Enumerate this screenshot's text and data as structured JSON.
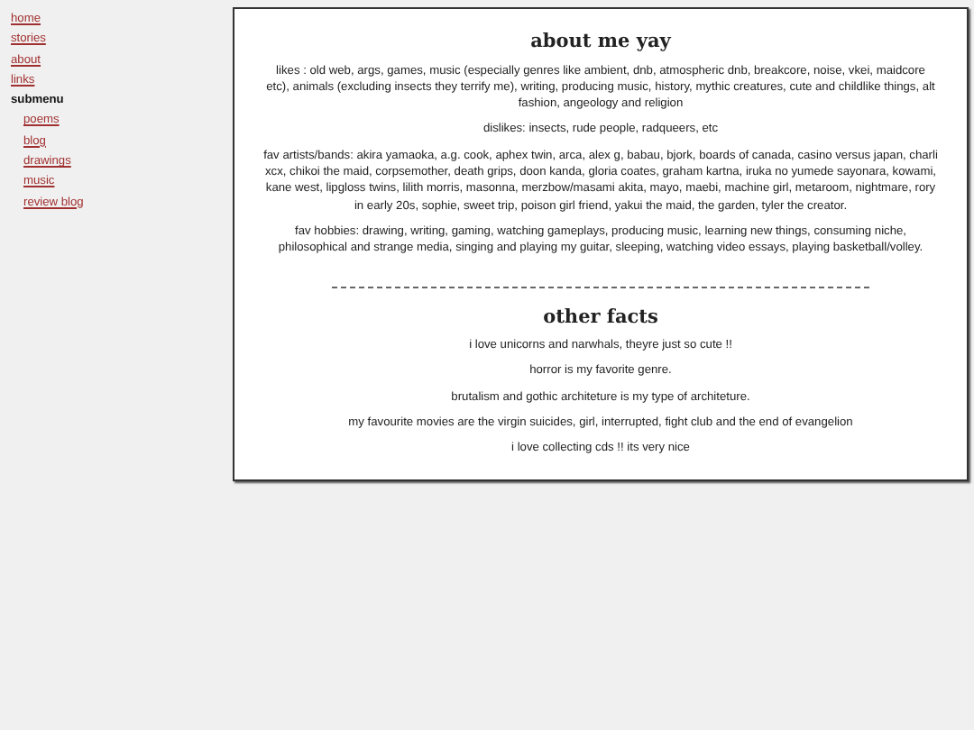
{
  "sidebar": {
    "items": [
      {
        "label": "home",
        "kind": "link"
      },
      {
        "label": "stories",
        "kind": "link"
      },
      {
        "label": "about",
        "kind": "link"
      },
      {
        "label": "links",
        "kind": "link"
      },
      {
        "label": "submenu",
        "kind": "heading",
        "children": [
          {
            "label": "poems"
          },
          {
            "label": "blog"
          },
          {
            "label": "drawings"
          },
          {
            "label": "music"
          },
          {
            "label": "review blog"
          }
        ]
      }
    ]
  },
  "main": {
    "sections": [
      {
        "title": "about me yay",
        "paragraphs": [
          "likes : old web, args, games, music (especially genres like ambient, dnb, atmospheric dnb, breakcore, noise, vkei, maidcore etc), animals (excluding insects they terrify me), writing, producing music, history, mythic creatures, cute and childlike things, alt fashion, angeology and religion",
          "dislikes: insects, rude people, radqueers, etc",
          "fav artists/bands: akira yamaoka, a.g. cook, aphex twin, arca, alex g, babau, bjork, boards of canada, casino versus japan, charli xcx, chikoi the maid, corpsemother, death grips, doon kanda, gloria coates, graham kartna, iruka no yumede sayonara, kowami, kane west, lipgloss twins, lilith morris, masonna, merzbow/masami akita, mayo, maebi, machine girl, metaroom, nightmare, rory in early 20s, sophie, sweet trip, poison girl friend, yakui the maid, the garden, tyler the creator.",
          "fav hobbies: drawing, writing, gaming, watching gameplays, producing music, learning new things, consuming niche, philosophical and strange media, singing and playing my guitar, sleeping, watching video essays, playing basketball/volley."
        ]
      },
      {
        "title": "other facts",
        "paragraphs": [
          "i love unicorns and narwhals, theyre just so cute !!",
          "horror is my favorite genre.",
          "brutalism and gothic architeture is my type of architeture.",
          "my favourite movies are the virgin suicides, girl, interrupted, fight club and the end of evangelion",
          "i love collecting cds !! its very nice"
        ]
      }
    ]
  }
}
